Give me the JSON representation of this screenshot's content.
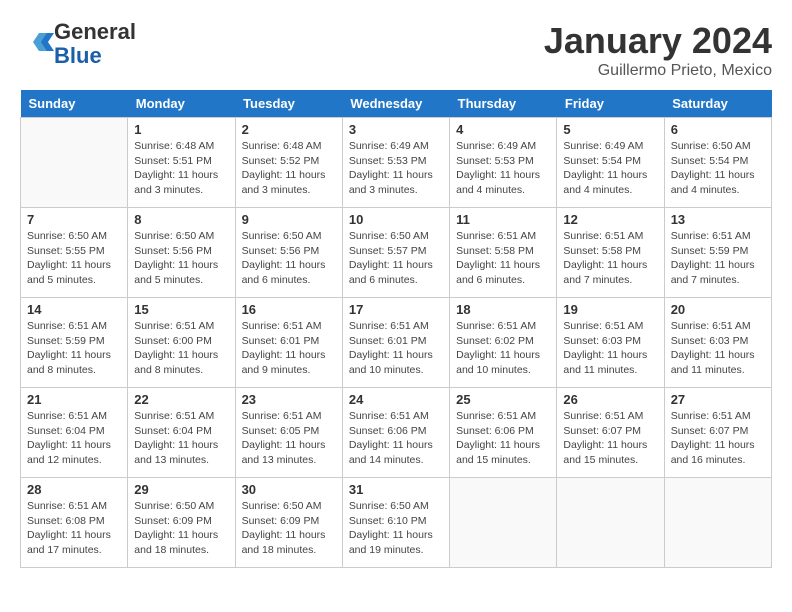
{
  "header": {
    "logo_general": "General",
    "logo_blue": "Blue",
    "month_title": "January 2024",
    "location": "Guillermo Prieto, Mexico"
  },
  "days_of_week": [
    "Sunday",
    "Monday",
    "Tuesday",
    "Wednesday",
    "Thursday",
    "Friday",
    "Saturday"
  ],
  "weeks": [
    [
      {
        "day": "",
        "info": ""
      },
      {
        "day": "1",
        "info": "Sunrise: 6:48 AM\nSunset: 5:51 PM\nDaylight: 11 hours\nand 3 minutes."
      },
      {
        "day": "2",
        "info": "Sunrise: 6:48 AM\nSunset: 5:52 PM\nDaylight: 11 hours\nand 3 minutes."
      },
      {
        "day": "3",
        "info": "Sunrise: 6:49 AM\nSunset: 5:53 PM\nDaylight: 11 hours\nand 3 minutes."
      },
      {
        "day": "4",
        "info": "Sunrise: 6:49 AM\nSunset: 5:53 PM\nDaylight: 11 hours\nand 4 minutes."
      },
      {
        "day": "5",
        "info": "Sunrise: 6:49 AM\nSunset: 5:54 PM\nDaylight: 11 hours\nand 4 minutes."
      },
      {
        "day": "6",
        "info": "Sunrise: 6:50 AM\nSunset: 5:54 PM\nDaylight: 11 hours\nand 4 minutes."
      }
    ],
    [
      {
        "day": "7",
        "info": "Sunrise: 6:50 AM\nSunset: 5:55 PM\nDaylight: 11 hours\nand 5 minutes."
      },
      {
        "day": "8",
        "info": "Sunrise: 6:50 AM\nSunset: 5:56 PM\nDaylight: 11 hours\nand 5 minutes."
      },
      {
        "day": "9",
        "info": "Sunrise: 6:50 AM\nSunset: 5:56 PM\nDaylight: 11 hours\nand 6 minutes."
      },
      {
        "day": "10",
        "info": "Sunrise: 6:50 AM\nSunset: 5:57 PM\nDaylight: 11 hours\nand 6 minutes."
      },
      {
        "day": "11",
        "info": "Sunrise: 6:51 AM\nSunset: 5:58 PM\nDaylight: 11 hours\nand 6 minutes."
      },
      {
        "day": "12",
        "info": "Sunrise: 6:51 AM\nSunset: 5:58 PM\nDaylight: 11 hours\nand 7 minutes."
      },
      {
        "day": "13",
        "info": "Sunrise: 6:51 AM\nSunset: 5:59 PM\nDaylight: 11 hours\nand 7 minutes."
      }
    ],
    [
      {
        "day": "14",
        "info": "Sunrise: 6:51 AM\nSunset: 5:59 PM\nDaylight: 11 hours\nand 8 minutes."
      },
      {
        "day": "15",
        "info": "Sunrise: 6:51 AM\nSunset: 6:00 PM\nDaylight: 11 hours\nand 8 minutes."
      },
      {
        "day": "16",
        "info": "Sunrise: 6:51 AM\nSunset: 6:01 PM\nDaylight: 11 hours\nand 9 minutes."
      },
      {
        "day": "17",
        "info": "Sunrise: 6:51 AM\nSunset: 6:01 PM\nDaylight: 11 hours\nand 10 minutes."
      },
      {
        "day": "18",
        "info": "Sunrise: 6:51 AM\nSunset: 6:02 PM\nDaylight: 11 hours\nand 10 minutes."
      },
      {
        "day": "19",
        "info": "Sunrise: 6:51 AM\nSunset: 6:03 PM\nDaylight: 11 hours\nand 11 minutes."
      },
      {
        "day": "20",
        "info": "Sunrise: 6:51 AM\nSunset: 6:03 PM\nDaylight: 11 hours\nand 11 minutes."
      }
    ],
    [
      {
        "day": "21",
        "info": "Sunrise: 6:51 AM\nSunset: 6:04 PM\nDaylight: 11 hours\nand 12 minutes."
      },
      {
        "day": "22",
        "info": "Sunrise: 6:51 AM\nSunset: 6:04 PM\nDaylight: 11 hours\nand 13 minutes."
      },
      {
        "day": "23",
        "info": "Sunrise: 6:51 AM\nSunset: 6:05 PM\nDaylight: 11 hours\nand 13 minutes."
      },
      {
        "day": "24",
        "info": "Sunrise: 6:51 AM\nSunset: 6:06 PM\nDaylight: 11 hours\nand 14 minutes."
      },
      {
        "day": "25",
        "info": "Sunrise: 6:51 AM\nSunset: 6:06 PM\nDaylight: 11 hours\nand 15 minutes."
      },
      {
        "day": "26",
        "info": "Sunrise: 6:51 AM\nSunset: 6:07 PM\nDaylight: 11 hours\nand 15 minutes."
      },
      {
        "day": "27",
        "info": "Sunrise: 6:51 AM\nSunset: 6:07 PM\nDaylight: 11 hours\nand 16 minutes."
      }
    ],
    [
      {
        "day": "28",
        "info": "Sunrise: 6:51 AM\nSunset: 6:08 PM\nDaylight: 11 hours\nand 17 minutes."
      },
      {
        "day": "29",
        "info": "Sunrise: 6:50 AM\nSunset: 6:09 PM\nDaylight: 11 hours\nand 18 minutes."
      },
      {
        "day": "30",
        "info": "Sunrise: 6:50 AM\nSunset: 6:09 PM\nDaylight: 11 hours\nand 18 minutes."
      },
      {
        "day": "31",
        "info": "Sunrise: 6:50 AM\nSunset: 6:10 PM\nDaylight: 11 hours\nand 19 minutes."
      },
      {
        "day": "",
        "info": ""
      },
      {
        "day": "",
        "info": ""
      },
      {
        "day": "",
        "info": ""
      }
    ]
  ]
}
